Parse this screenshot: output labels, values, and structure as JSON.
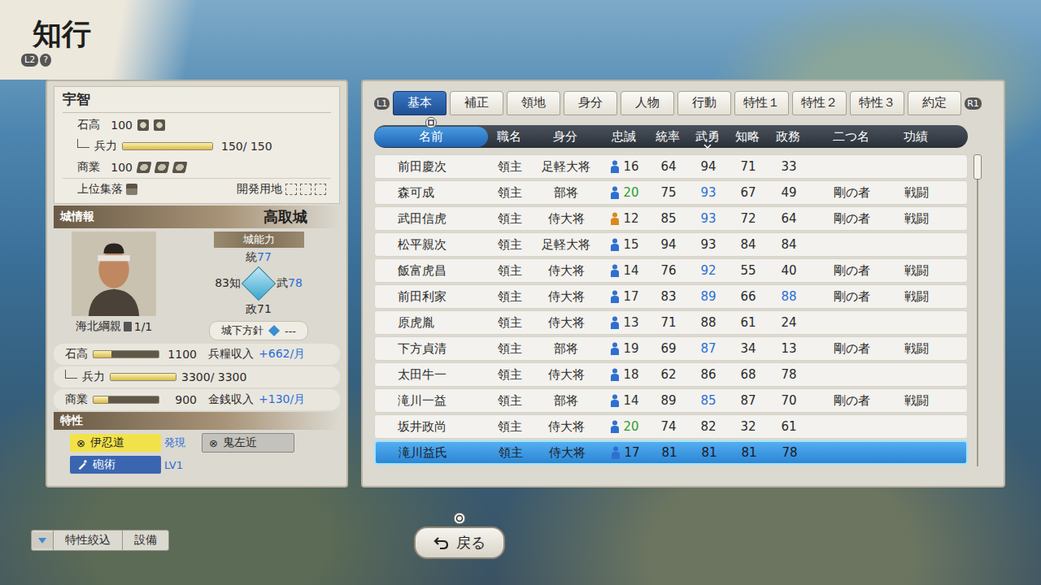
{
  "screen": {
    "title": "知行",
    "buttons": [
      "L2",
      "?"
    ]
  },
  "village": {
    "name": "宇智",
    "kokudaka": {
      "label": "石高",
      "value": "100",
      "stars": 2
    },
    "troops": {
      "label": "兵力",
      "reading": "150/ 150",
      "level": 1
    },
    "commerce": {
      "label": "商業",
      "value": "100",
      "stars": 3
    },
    "upper_settlement": {
      "label": "上位集落"
    },
    "dev_land": {
      "label": "開発用地",
      "empty_slots": 3
    }
  },
  "castle": {
    "header": "城情報",
    "name": "高取城",
    "ability_label": "城能力",
    "abilities": {
      "top": {
        "label": "統",
        "value": "77",
        "high": true
      },
      "left": {
        "label": "知",
        "value": "83",
        "high": false
      },
      "right": {
        "label": "武",
        "value": "78",
        "high": true
      },
      "bottom": {
        "label": "政",
        "value": "71",
        "high": false
      }
    },
    "lord": {
      "name": "海北綱親",
      "count": "1/1"
    },
    "policy": {
      "label": "城下方針",
      "value": "---"
    },
    "stats": [
      {
        "label": "石高",
        "value": "1100",
        "level": 0.28,
        "sub_label": "兵糧収入",
        "sub_value": "+662/月",
        "indent": false
      },
      {
        "label": "兵力",
        "value": "3300/ 3300",
        "level": 1,
        "indent": true
      },
      {
        "label": "商業",
        "value": "900",
        "level": 0.22,
        "sub_label": "金銭収入",
        "sub_value": "+130/月",
        "indent": false
      }
    ]
  },
  "traits": {
    "header": "特性",
    "items": [
      {
        "label": "伊忍道",
        "mark": "⊗",
        "note": "発現",
        "kind": "active"
      },
      {
        "label": "鬼左近",
        "mark": "⊗",
        "kind": "inactive"
      },
      {
        "label": "砲術",
        "note": "LV1",
        "kind": "skill"
      }
    ]
  },
  "shoulder_buttons": {
    "left": "L1",
    "right": "R1"
  },
  "tabs": [
    {
      "label": "基本",
      "selected": true
    },
    {
      "label": "補正",
      "selected": false
    },
    {
      "label": "領地",
      "selected": false
    },
    {
      "label": "身分",
      "selected": false
    },
    {
      "label": "人物",
      "selected": false
    },
    {
      "label": "行動",
      "selected": false
    },
    {
      "label": "特性１",
      "selected": false
    },
    {
      "label": "特性２",
      "selected": false
    },
    {
      "label": "特性３",
      "selected": false
    },
    {
      "label": "約定",
      "selected": false
    }
  ],
  "table": {
    "columns": [
      {
        "label": "名前",
        "selected": true,
        "sorted": false
      },
      {
        "label": "職名",
        "selected": false,
        "sorted": false
      },
      {
        "label": "身分",
        "selected": false,
        "sorted": false
      },
      {
        "label": "忠誠",
        "selected": false,
        "sorted": false
      },
      {
        "label": "統率",
        "selected": false,
        "sorted": false
      },
      {
        "label": "武勇",
        "selected": false,
        "sorted": true
      },
      {
        "label": "知略",
        "selected": false,
        "sorted": false
      },
      {
        "label": "政務",
        "selected": false,
        "sorted": false
      },
      {
        "label": "二つ名",
        "selected": false,
        "sorted": false
      },
      {
        "label": "功績",
        "selected": false,
        "sorted": false
      }
    ],
    "rows": [
      {
        "name": "前田慶次",
        "post": "領主",
        "rank": "足軽大将",
        "loyalty": {
          "value": "16",
          "icon_color": "#2f6fd0",
          "value_color": "#333333"
        },
        "stats": [
          {
            "value": "64",
            "high": false
          },
          {
            "value": "94",
            "high": false
          },
          {
            "value": "71",
            "high": false
          },
          {
            "value": "33",
            "high": false
          }
        ],
        "selected": false
      },
      {
        "name": "森可成",
        "post": "領主",
        "rank": "部将",
        "loyalty": {
          "value": "20",
          "icon_color": "#2f6fd0",
          "value_color": "#2e9e2e"
        },
        "stats": [
          {
            "value": "75",
            "high": false
          },
          {
            "value": "93",
            "high": true
          },
          {
            "value": "67",
            "high": false
          },
          {
            "value": "49",
            "high": false
          }
        ],
        "nickname": "剛の者",
        "merit": "戦闘",
        "selected": false
      },
      {
        "name": "武田信虎",
        "post": "領主",
        "rank": "侍大将",
        "loyalty": {
          "value": "12",
          "icon_color": "#d98a1a",
          "value_color": "#333333"
        },
        "stats": [
          {
            "value": "85",
            "high": false
          },
          {
            "value": "93",
            "high": true
          },
          {
            "value": "72",
            "high": false
          },
          {
            "value": "64",
            "high": false
          }
        ],
        "nickname": "剛の者",
        "merit": "戦闘",
        "selected": false
      },
      {
        "name": "松平親次",
        "post": "領主",
        "rank": "足軽大将",
        "loyalty": {
          "value": "15",
          "icon_color": "#2f6fd0",
          "value_color": "#333333"
        },
        "stats": [
          {
            "value": "94",
            "high": false
          },
          {
            "value": "93",
            "high": false
          },
          {
            "value": "84",
            "high": false
          },
          {
            "value": "84",
            "high": false
          }
        ],
        "selected": false
      },
      {
        "name": "飯富虎昌",
        "post": "領主",
        "rank": "侍大将",
        "loyalty": {
          "value": "14",
          "icon_color": "#2f6fd0",
          "value_color": "#333333"
        },
        "stats": [
          {
            "value": "76",
            "high": false
          },
          {
            "value": "92",
            "high": true
          },
          {
            "value": "55",
            "high": false
          },
          {
            "value": "40",
            "high": false
          }
        ],
        "nickname": "剛の者",
        "merit": "戦闘",
        "selected": false
      },
      {
        "name": "前田利家",
        "post": "領主",
        "rank": "侍大将",
        "loyalty": {
          "value": "17",
          "icon_color": "#2f6fd0",
          "value_color": "#333333"
        },
        "stats": [
          {
            "value": "83",
            "high": false
          },
          {
            "value": "89",
            "high": true
          },
          {
            "value": "66",
            "high": false
          },
          {
            "value": "88",
            "high": true
          }
        ],
        "nickname": "剛の者",
        "merit": "戦闘",
        "selected": false
      },
      {
        "name": "原虎胤",
        "post": "領主",
        "rank": "侍大将",
        "loyalty": {
          "value": "13",
          "icon_color": "#2f6fd0",
          "value_color": "#333333"
        },
        "stats": [
          {
            "value": "71",
            "high": false
          },
          {
            "value": "88",
            "high": false
          },
          {
            "value": "61",
            "high": false
          },
          {
            "value": "24",
            "high": false
          }
        ],
        "selected": false
      },
      {
        "name": "下方貞清",
        "post": "領主",
        "rank": "部将",
        "loyalty": {
          "value": "19",
          "icon_color": "#2f6fd0",
          "value_color": "#333333"
        },
        "stats": [
          {
            "value": "69",
            "high": false
          },
          {
            "value": "87",
            "high": true
          },
          {
            "value": "34",
            "high": false
          },
          {
            "value": "13",
            "high": false
          }
        ],
        "nickname": "剛の者",
        "merit": "戦闘",
        "selected": false
      },
      {
        "name": "太田牛一",
        "post": "領主",
        "rank": "侍大将",
        "loyalty": {
          "value": "18",
          "icon_color": "#2f6fd0",
          "value_color": "#333333"
        },
        "stats": [
          {
            "value": "62",
            "high": false
          },
          {
            "value": "86",
            "high": false
          },
          {
            "value": "68",
            "high": false
          },
          {
            "value": "78",
            "high": false
          }
        ],
        "selected": false
      },
      {
        "name": "滝川一益",
        "post": "領主",
        "rank": "部将",
        "loyalty": {
          "value": "14",
          "icon_color": "#2f6fd0",
          "value_color": "#333333"
        },
        "stats": [
          {
            "value": "89",
            "high": false
          },
          {
            "value": "85",
            "high": true
          },
          {
            "value": "87",
            "high": false
          },
          {
            "value": "70",
            "high": false
          }
        ],
        "nickname": "剛の者",
        "merit": "戦闘",
        "selected": false
      },
      {
        "name": "坂井政尚",
        "post": "領主",
        "rank": "侍大将",
        "loyalty": {
          "value": "20",
          "icon_color": "#2f6fd0",
          "value_color": "#2e9e2e"
        },
        "stats": [
          {
            "value": "74",
            "high": false
          },
          {
            "value": "82",
            "high": false
          },
          {
            "value": "32",
            "high": false
          },
          {
            "value": "61",
            "high": false
          }
        ],
        "selected": false
      },
      {
        "name": "滝川益氏",
        "post": "領主",
        "rank": "侍大将",
        "loyalty": {
          "value": "17",
          "icon_color": "#2f6fd0",
          "value_color": "#1a1a2a"
        },
        "stats": [
          {
            "value": "81",
            "high": false
          },
          {
            "value": "81",
            "high": false
          },
          {
            "value": "81",
            "high": false
          },
          {
            "value": "78",
            "high": false
          }
        ],
        "selected": true
      }
    ],
    "scroll_level": 0.08
  },
  "footer": {
    "filter_buttons": [
      "特性絞込",
      "設備"
    ],
    "back": "戻る"
  }
}
